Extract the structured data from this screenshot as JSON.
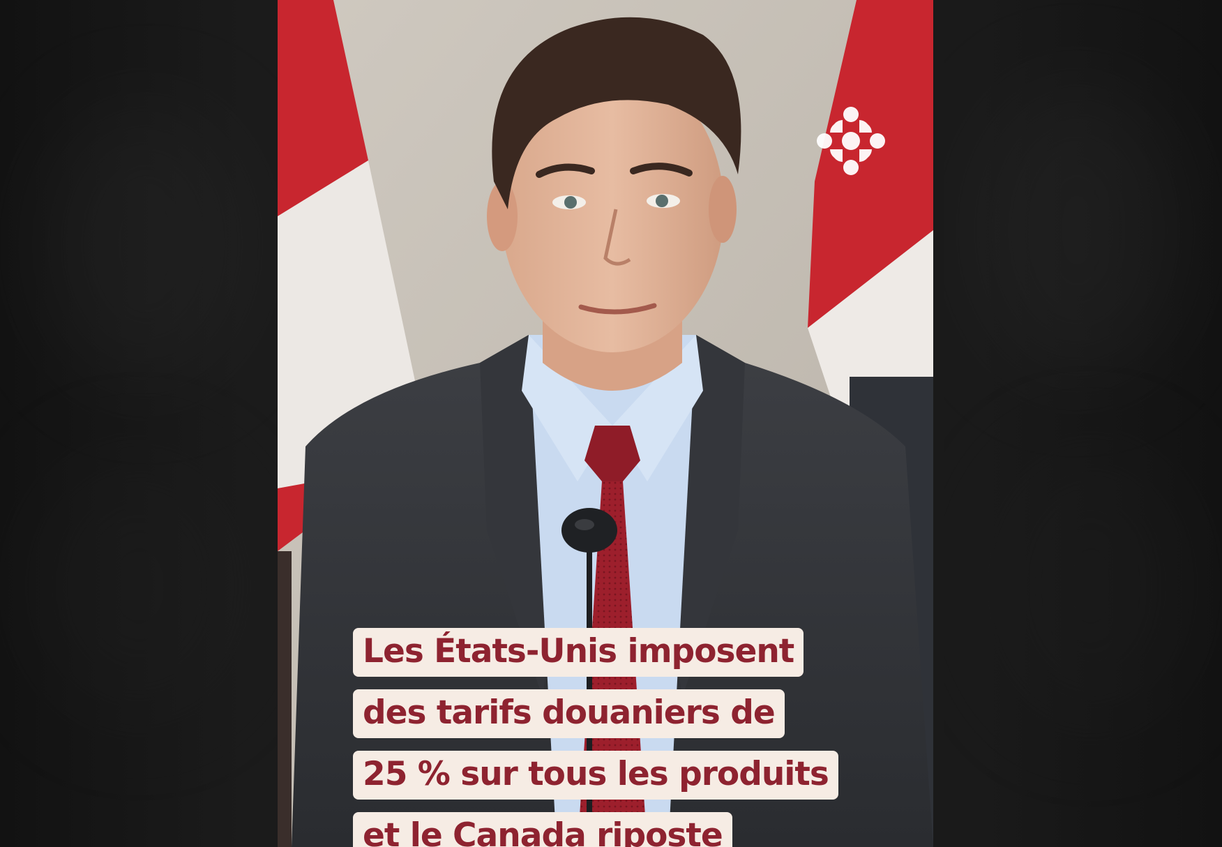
{
  "video": {
    "logo_icon": "radio-canada-gem-icon",
    "caption_lines": [
      "Les États-Unis imposent",
      "des tarifs douaniers de",
      "25 % sur tous les produits",
      "et le Canada riposte"
    ]
  },
  "colors": {
    "caption_text": "#8e2330",
    "caption_bg": "#f6ece4",
    "flag_red": "#c8262f"
  }
}
